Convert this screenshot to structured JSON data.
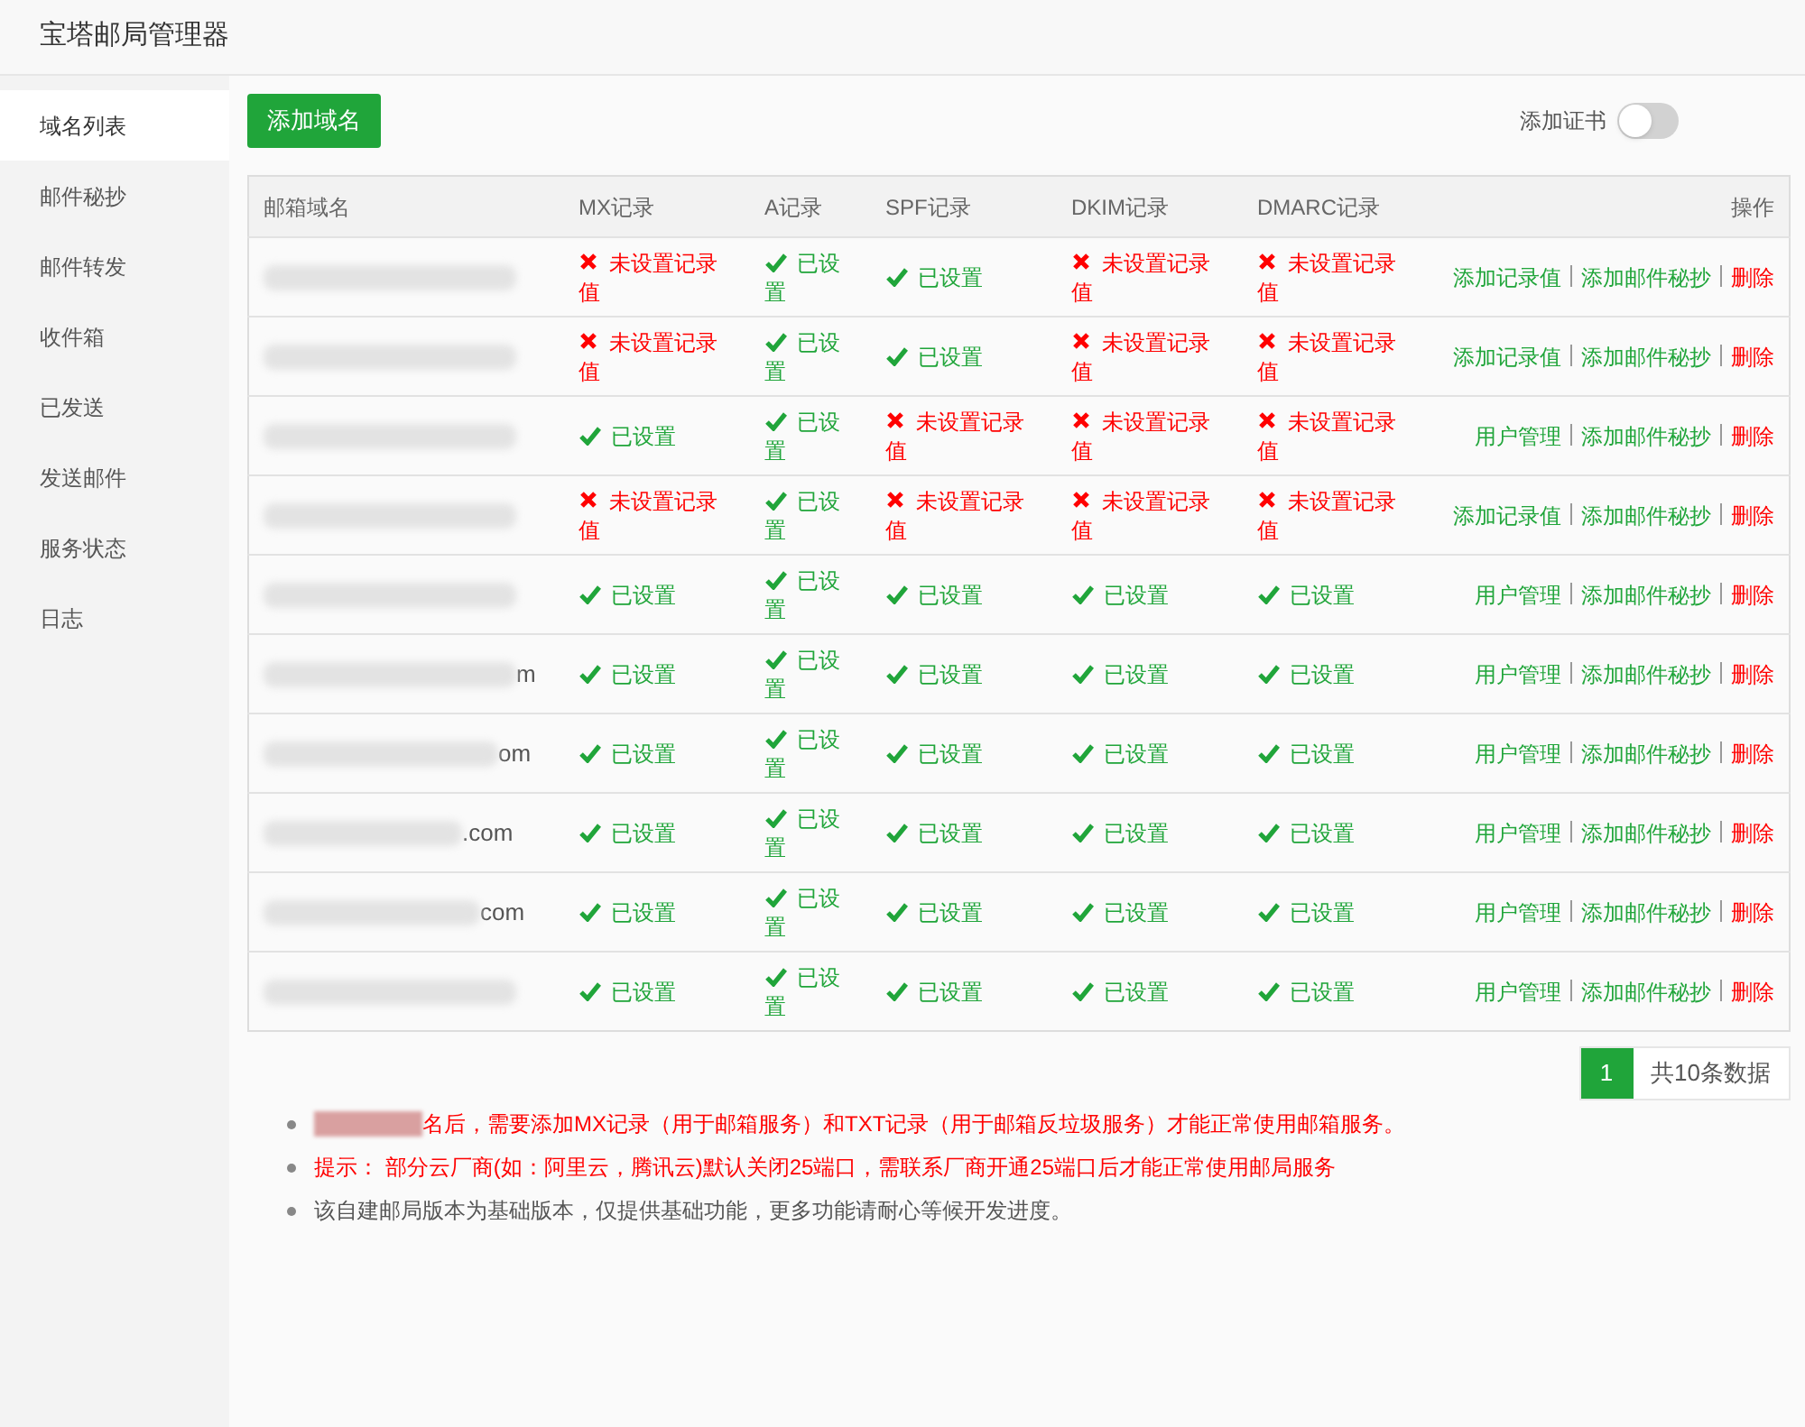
{
  "window": {
    "title": "宝塔邮局管理器"
  },
  "sidebar": {
    "items": [
      {
        "label": "域名列表",
        "selected": true
      },
      {
        "label": "邮件秘抄",
        "selected": false
      },
      {
        "label": "邮件转发",
        "selected": false
      },
      {
        "label": "收件箱",
        "selected": false
      },
      {
        "label": "已发送",
        "selected": false
      },
      {
        "label": "发送邮件",
        "selected": false
      },
      {
        "label": "服务状态",
        "selected": false
      },
      {
        "label": "日志",
        "selected": false
      }
    ]
  },
  "add_domain_button": "添加域名",
  "certificate_toggle": {
    "label": "添加证书",
    "on": false
  },
  "table": {
    "columns": [
      "邮箱域名",
      "MX记录",
      "A记录",
      "SPF记录",
      "DKIM记录",
      "DMARC记录",
      "操作"
    ],
    "rows": [
      {
        "domain": "",
        "records": [
          {
            "ok": false,
            "text": "未设置记录值"
          },
          {
            "ok": true,
            "text": "已设置"
          },
          {
            "ok": true,
            "text": "已设置"
          },
          {
            "ok": false,
            "text": "未设置记录值"
          },
          {
            "ok": false,
            "text": "未设置记录值"
          }
        ],
        "actions": [
          "添加记录值",
          "添加邮件秘抄",
          "删除"
        ]
      },
      {
        "domain": "",
        "records": [
          {
            "ok": false,
            "text": "未设置记录值"
          },
          {
            "ok": true,
            "text": "已设置"
          },
          {
            "ok": true,
            "text": "已设置"
          },
          {
            "ok": false,
            "text": "未设置记录值"
          },
          {
            "ok": false,
            "text": "未设置记录值"
          }
        ],
        "actions": [
          "添加记录值",
          "添加邮件秘抄",
          "删除"
        ]
      },
      {
        "domain": "",
        "records": [
          {
            "ok": true,
            "text": "已设置"
          },
          {
            "ok": true,
            "text": "已设置"
          },
          {
            "ok": false,
            "text": "未设置记录值"
          },
          {
            "ok": false,
            "text": "未设置记录值"
          },
          {
            "ok": false,
            "text": "未设置记录值"
          }
        ],
        "actions": [
          "用户管理",
          "添加邮件秘抄",
          "删除"
        ]
      },
      {
        "domain": "",
        "records": [
          {
            "ok": false,
            "text": "未设置记录值"
          },
          {
            "ok": true,
            "text": "已设置"
          },
          {
            "ok": false,
            "text": "未设置记录值"
          },
          {
            "ok": false,
            "text": "未设置记录值"
          },
          {
            "ok": false,
            "text": "未设置记录值"
          }
        ],
        "actions": [
          "添加记录值",
          "添加邮件秘抄",
          "删除"
        ]
      },
      {
        "domain": "",
        "records": [
          {
            "ok": true,
            "text": "已设置"
          },
          {
            "ok": true,
            "text": "已设置"
          },
          {
            "ok": true,
            "text": "已设置"
          },
          {
            "ok": true,
            "text": "已设置"
          },
          {
            "ok": true,
            "text": "已设置"
          }
        ],
        "actions": [
          "用户管理",
          "添加邮件秘抄",
          "删除"
        ]
      },
      {
        "domain": "m",
        "records": [
          {
            "ok": true,
            "text": "已设置"
          },
          {
            "ok": true,
            "text": "已设置"
          },
          {
            "ok": true,
            "text": "已设置"
          },
          {
            "ok": true,
            "text": "已设置"
          },
          {
            "ok": true,
            "text": "已设置"
          }
        ],
        "actions": [
          "用户管理",
          "添加邮件秘抄",
          "删除"
        ]
      },
      {
        "domain": "om",
        "records": [
          {
            "ok": true,
            "text": "已设置"
          },
          {
            "ok": true,
            "text": "已设置"
          },
          {
            "ok": true,
            "text": "已设置"
          },
          {
            "ok": true,
            "text": "已设置"
          },
          {
            "ok": true,
            "text": "已设置"
          }
        ],
        "actions": [
          "用户管理",
          "添加邮件秘抄",
          "删除"
        ]
      },
      {
        "domain": ".com",
        "records": [
          {
            "ok": true,
            "text": "已设置"
          },
          {
            "ok": true,
            "text": "已设置"
          },
          {
            "ok": true,
            "text": "已设置"
          },
          {
            "ok": true,
            "text": "已设置"
          },
          {
            "ok": true,
            "text": "已设置"
          }
        ],
        "actions": [
          "用户管理",
          "添加邮件秘抄",
          "删除"
        ]
      },
      {
        "domain": "com",
        "records": [
          {
            "ok": true,
            "text": "已设置"
          },
          {
            "ok": true,
            "text": "已设置"
          },
          {
            "ok": true,
            "text": "已设置"
          },
          {
            "ok": true,
            "text": "已设置"
          },
          {
            "ok": true,
            "text": "已设置"
          }
        ],
        "actions": [
          "用户管理",
          "添加邮件秘抄",
          "删除"
        ]
      },
      {
        "domain": "",
        "records": [
          {
            "ok": true,
            "text": "已设置"
          },
          {
            "ok": true,
            "text": "已设置"
          },
          {
            "ok": true,
            "text": "已设置"
          },
          {
            "ok": true,
            "text": "已设置"
          },
          {
            "ok": true,
            "text": "已设置"
          }
        ],
        "actions": [
          "用户管理",
          "添加邮件秘抄",
          "删除"
        ]
      }
    ]
  },
  "pagination": {
    "pages": [
      {
        "label": "1",
        "selected": true
      }
    ],
    "total": "共10条数据"
  },
  "notes": [
    {
      "text": "名后，需要添加MX记录（用于邮箱服务）和TXT记录（用于邮箱反垃圾服务）才能正常使用邮箱服务。",
      "warning": true
    },
    {
      "text": "提示： 部分云厂商(如：阿里云，腾讯云)默认关闭25端口，需联系厂商开通25端口后才能正常使用邮局服务",
      "warning": true
    },
    {
      "text": "该自建邮局版本为基础版本，仅提供基础功能，更多功能请耐心等候开发进度。",
      "warning": false
    }
  ]
}
